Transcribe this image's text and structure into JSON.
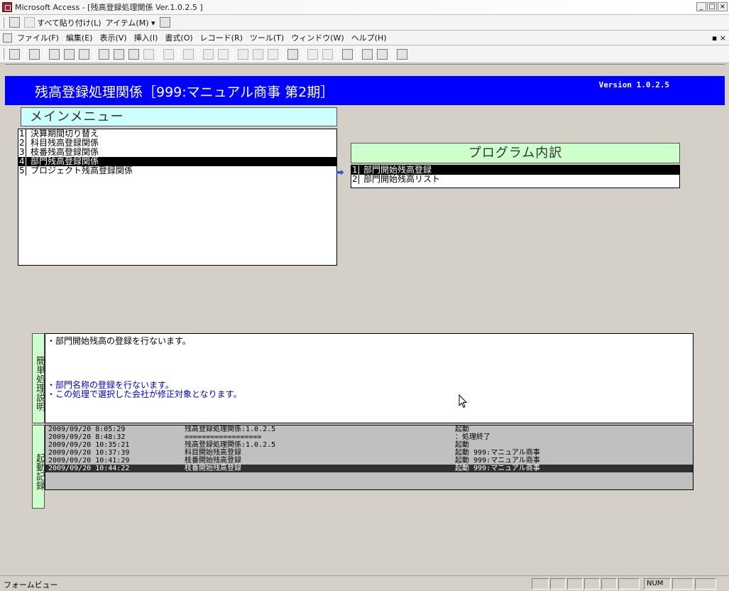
{
  "window": {
    "title": "Microsoft Access - [残高登録処理関係  Ver.1.0.2.5 ]",
    "controls": [
      "_",
      "□",
      "×"
    ]
  },
  "toolbar1": {
    "paste_all": "すべて貼り付け(L)",
    "items": "アイテム(M) ▾"
  },
  "menubar": {
    "items": [
      "ファイル(F)",
      "編集(E)",
      "表示(V)",
      "挿入(I)",
      "書式(O)",
      "レコード(R)",
      "ツール(T)",
      "ウィンドウ(W)",
      "ヘルプ(H)"
    ],
    "mdi_controls": "▪ ×"
  },
  "header": {
    "title": "残高登録処理関係［999:マニュアル商事 第2期］",
    "version": "Version 1.0.2.5"
  },
  "main_menu": {
    "title": "メインメニュー",
    "items": [
      {
        "num": "1",
        "label": "決算期間切り替え"
      },
      {
        "num": "2",
        "label": "科目残高登録関係"
      },
      {
        "num": "3",
        "label": "枝番残高登録関係"
      },
      {
        "num": "4",
        "label": "部門残高登録関係"
      },
      {
        "num": "5",
        "label": "プロジェクト残高登録関係"
      }
    ]
  },
  "program": {
    "title": "プログラム内訳",
    "items": [
      {
        "num": "1",
        "label": "部門開始残高登録"
      },
      {
        "num": "2",
        "label": "部門開始残高リスト"
      }
    ]
  },
  "description": {
    "label": "簡単処理説明",
    "line1": "・部門開始残高の登録を行ないます。",
    "line2": "・部門名称の登録を行ないます。",
    "line3": "・この処理で選択した会社が修正対象となります。"
  },
  "log": {
    "label": "起動記録",
    "rows": [
      {
        "time": "2009/09/20  8:05:29",
        "program": "残高登録処理関係:1.0.2.5",
        "action": "起動"
      },
      {
        "time": "2009/09/20  8:48:32",
        "program": "==================",
        "action": "：処理終了"
      },
      {
        "time": "2009/09/20 10:35:21",
        "program": "残高登録処理関係:1.0.2.5",
        "action": "起動"
      },
      {
        "time": "2009/09/20 10:37:39",
        "program": "科目開始残高登録",
        "action": "起動 999:マニュアル商事"
      },
      {
        "time": "2009/09/20 10:41:29",
        "program": "枝番開始残高登録",
        "action": "起動 999:マニュアル商事"
      },
      {
        "time": "2009/09/20 10:44:22",
        "program": "枝番開始残高登録",
        "action": "起動 999:マニュアル商事"
      }
    ]
  },
  "statusbar": {
    "text": "フォームビュー",
    "num": "NUM"
  }
}
